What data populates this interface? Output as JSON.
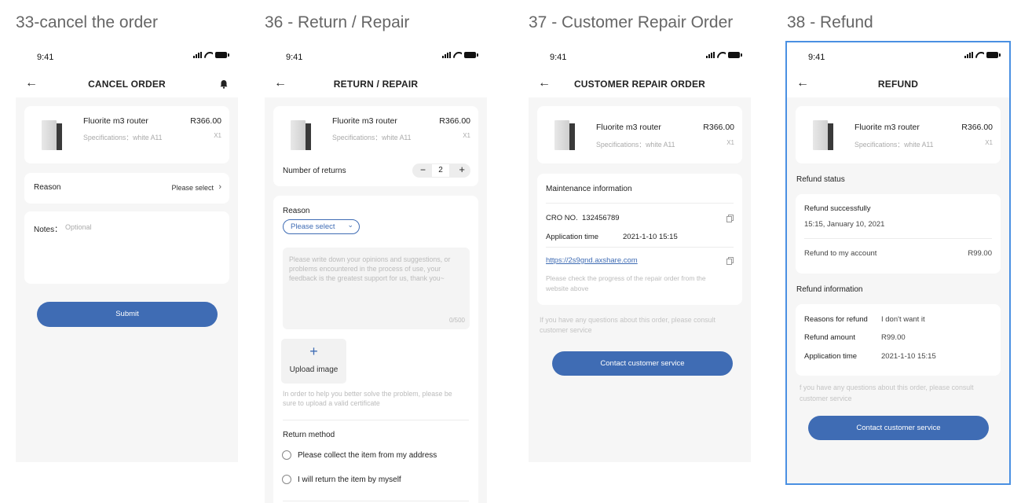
{
  "boards": [
    {
      "title": "33-cancel the order"
    },
    {
      "title": "36 - Return / Repair"
    },
    {
      "title": "37 - Customer Repair Order"
    },
    {
      "title": "38 - Refund"
    }
  ],
  "status": {
    "time": "9:41"
  },
  "product": {
    "name": "Fluorite m3 router",
    "price": "R366.00",
    "spec": "Specifications：white A11",
    "qty": "X1"
  },
  "cancel": {
    "nav_title": "CANCEL ORDER",
    "reason_label": "Reason",
    "reason_value": "Please select",
    "notes_label": "Notes：",
    "notes_placeholder": "Optional",
    "submit": "Submit"
  },
  "return": {
    "nav_title": "RETURN / REPAIR",
    "returns_label": "Number of returns",
    "minus": "−",
    "count": "2",
    "plus": "+",
    "reason_label": "Reason",
    "reason_select": "Please select",
    "textarea_placeholder": "Please write down your opinions and suggestions, or problems encountered in the process of use, your feedback is the greatest support for us, thank you~",
    "char_count": "0/500",
    "upload_plus": "+",
    "upload_label": "Upload image",
    "upload_hint": "In order to help you better solve the problem, please be sure to upload a valid certificate",
    "method_label": "Return method",
    "method_options": [
      "Please collect the item from my address",
      "I will return the item by myself"
    ]
  },
  "repair": {
    "nav_title": "CUSTOMER REPAIR ORDER",
    "section_title": "Maintenance information",
    "cro_label": "CRO NO.",
    "cro_value": "132456789",
    "app_time_label": "Application time",
    "app_time_value": "2021-1-10 15:15",
    "link": "https://2s9gnd.axshare.com",
    "link_hint": "Please check the progress of the repair order from the website above",
    "consult": "If you have any questions about this order, please consult customer service",
    "contact": "Contact customer service"
  },
  "refund": {
    "nav_title": "REFUND",
    "status_title": "Refund status",
    "status_value": "Refund successfully",
    "status_time": "15:15, January 10, 2021",
    "account_label": "Refund to my account",
    "account_value": "R99.00",
    "info_title": "Refund information",
    "reasons_label": "Reasons for refund",
    "reasons_value": "I don't want it",
    "amount_label": "Refund amount",
    "amount_value": "R99.00",
    "app_time_label": "Application time",
    "app_time_value": "2021-1-10 15:15",
    "consult": "f you have any questions about this order, please consult customer service",
    "contact": "Contact customer service"
  },
  "icons": {
    "back": "arrow-left-icon",
    "bell": "bell-icon",
    "chevron": "chevron-right-icon",
    "copy": "copy-icon",
    "radio": "radio-icon"
  },
  "colors": {
    "primary": "#3f6cb4",
    "selected_outline": "#4a90e2",
    "link": "#3f6cb4"
  }
}
